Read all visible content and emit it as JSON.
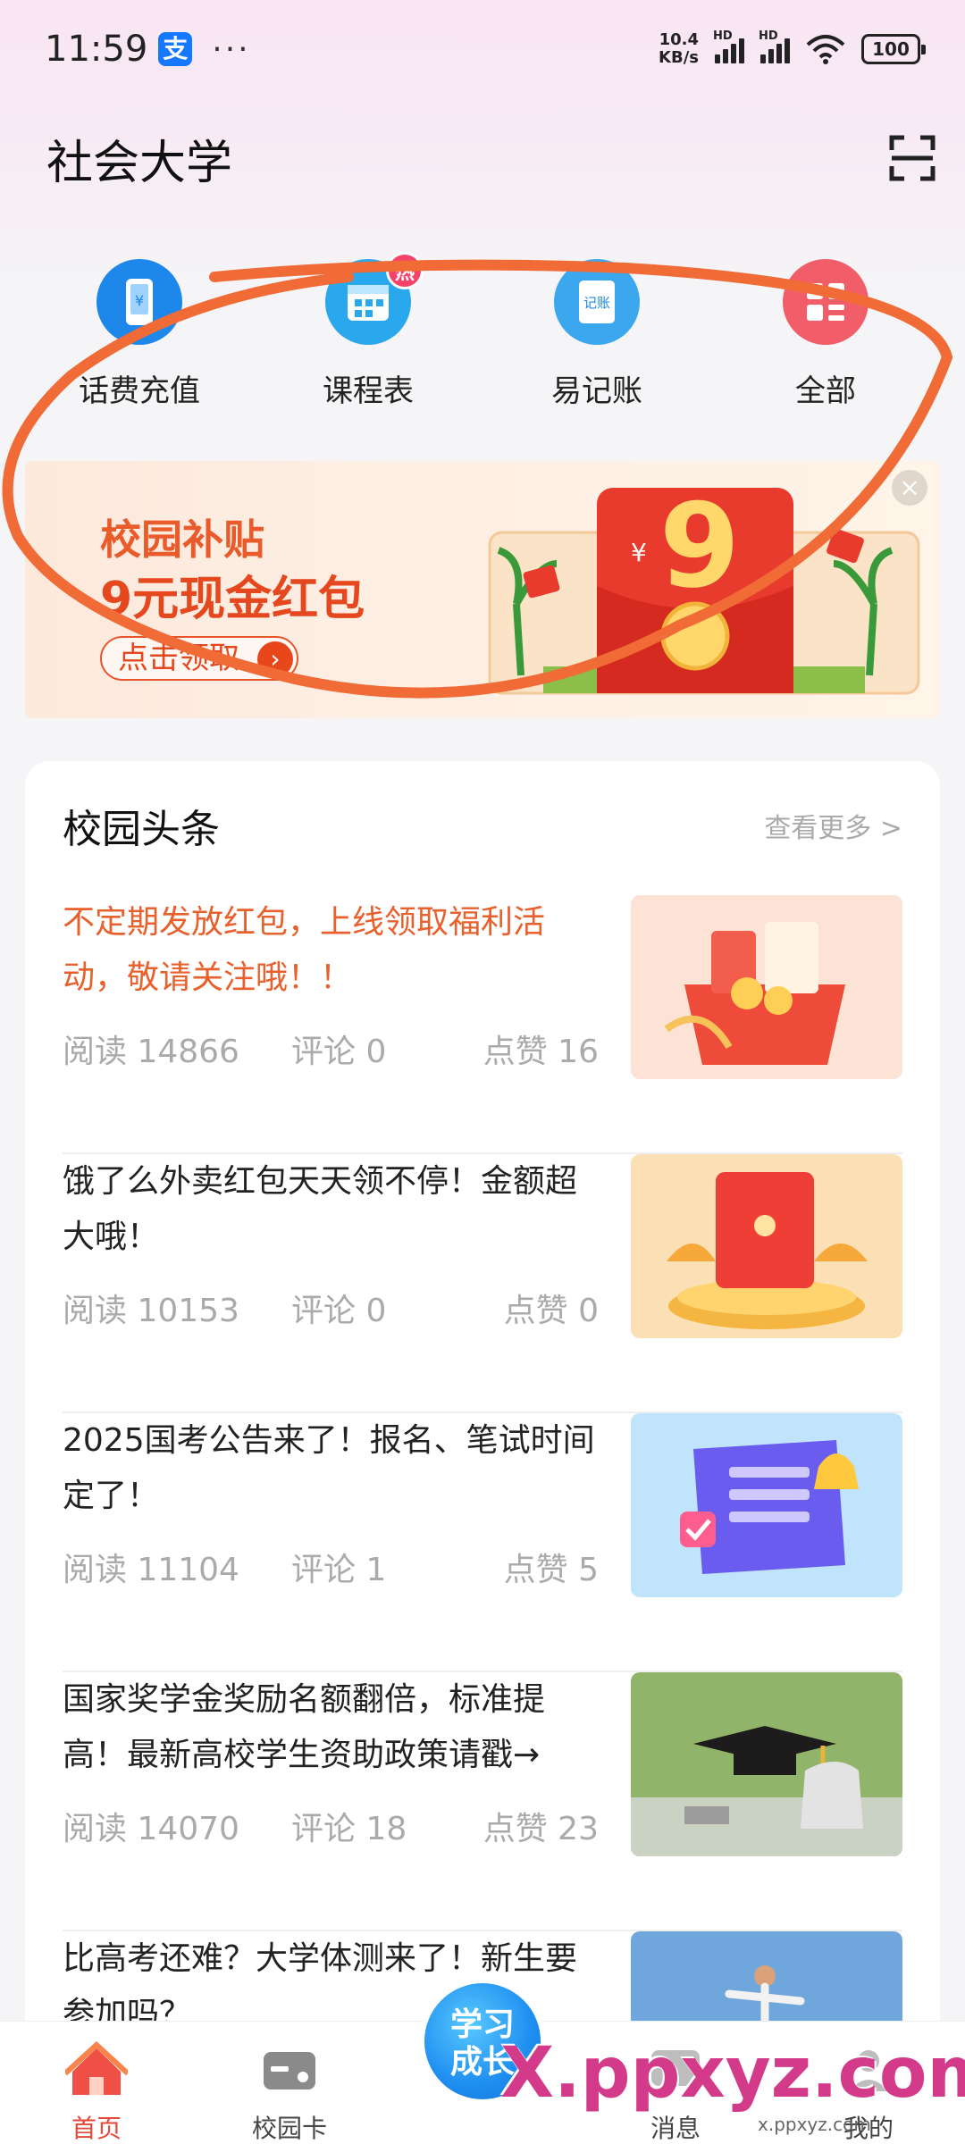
{
  "status_bar": {
    "time": "11:59",
    "alipay_badge": "支",
    "dots": "···",
    "net_speed_value": "10.4",
    "net_speed_unit": "KB/s",
    "signal_label": "HD",
    "battery": "100"
  },
  "header": {
    "title": "社会大学"
  },
  "quick_menu": {
    "items": [
      {
        "label": "话费充值",
        "icon": "phone-topup-icon",
        "color": "#1e88ea"
      },
      {
        "label": "课程表",
        "icon": "calendar-icon",
        "color": "#2aa8ee",
        "badge": "热"
      },
      {
        "label": "易记账",
        "icon": "ledger-icon",
        "color": "#3aa7ee"
      },
      {
        "label": "全部",
        "icon": "grid-icon",
        "color": "#f25d6a"
      }
    ]
  },
  "banner": {
    "subtitle": "校园补贴",
    "headline": "9元现金红包",
    "button_label": "点击领取",
    "art_number": "9",
    "art_currency": "¥"
  },
  "news": {
    "title": "校园头条",
    "more": "查看更多 >",
    "items": [
      {
        "text": "不定期发放红包，上线领取福利活动，敬请关注哦！！",
        "reads": "阅读 14866",
        "comments": "评论 0",
        "likes": "点赞 16",
        "highlight": true
      },
      {
        "text": "饿了么外卖红包天天领不停！金额超大哦！",
        "reads": "阅读 10153",
        "comments": "评论 0",
        "likes": "点赞 0"
      },
      {
        "text": "2025国考公告来了！报名、笔试时间定了！",
        "reads": "阅读 11104",
        "comments": "评论 1",
        "likes": "点赞 5"
      },
      {
        "text": "国家奖学金奖励名额翻倍，标准提高！最新高校学生资助政策请戳→",
        "reads": "阅读 14070",
        "comments": "评论 18",
        "likes": "点赞 23"
      },
      {
        "text": "比高考还难？大学体测来了！新生要参加吗？",
        "reads": "",
        "comments": "",
        "likes": ""
      }
    ]
  },
  "bottom_nav": {
    "items": [
      {
        "label": "首页",
        "active": true
      },
      {
        "label": "校园卡"
      },
      {
        "label": "消息"
      },
      {
        "label": "我的"
      }
    ],
    "center_line1": "学习",
    "center_line2": "成长"
  },
  "watermark": {
    "main": "X.ppxyz.com",
    "small": "x.ppxyz.com"
  }
}
